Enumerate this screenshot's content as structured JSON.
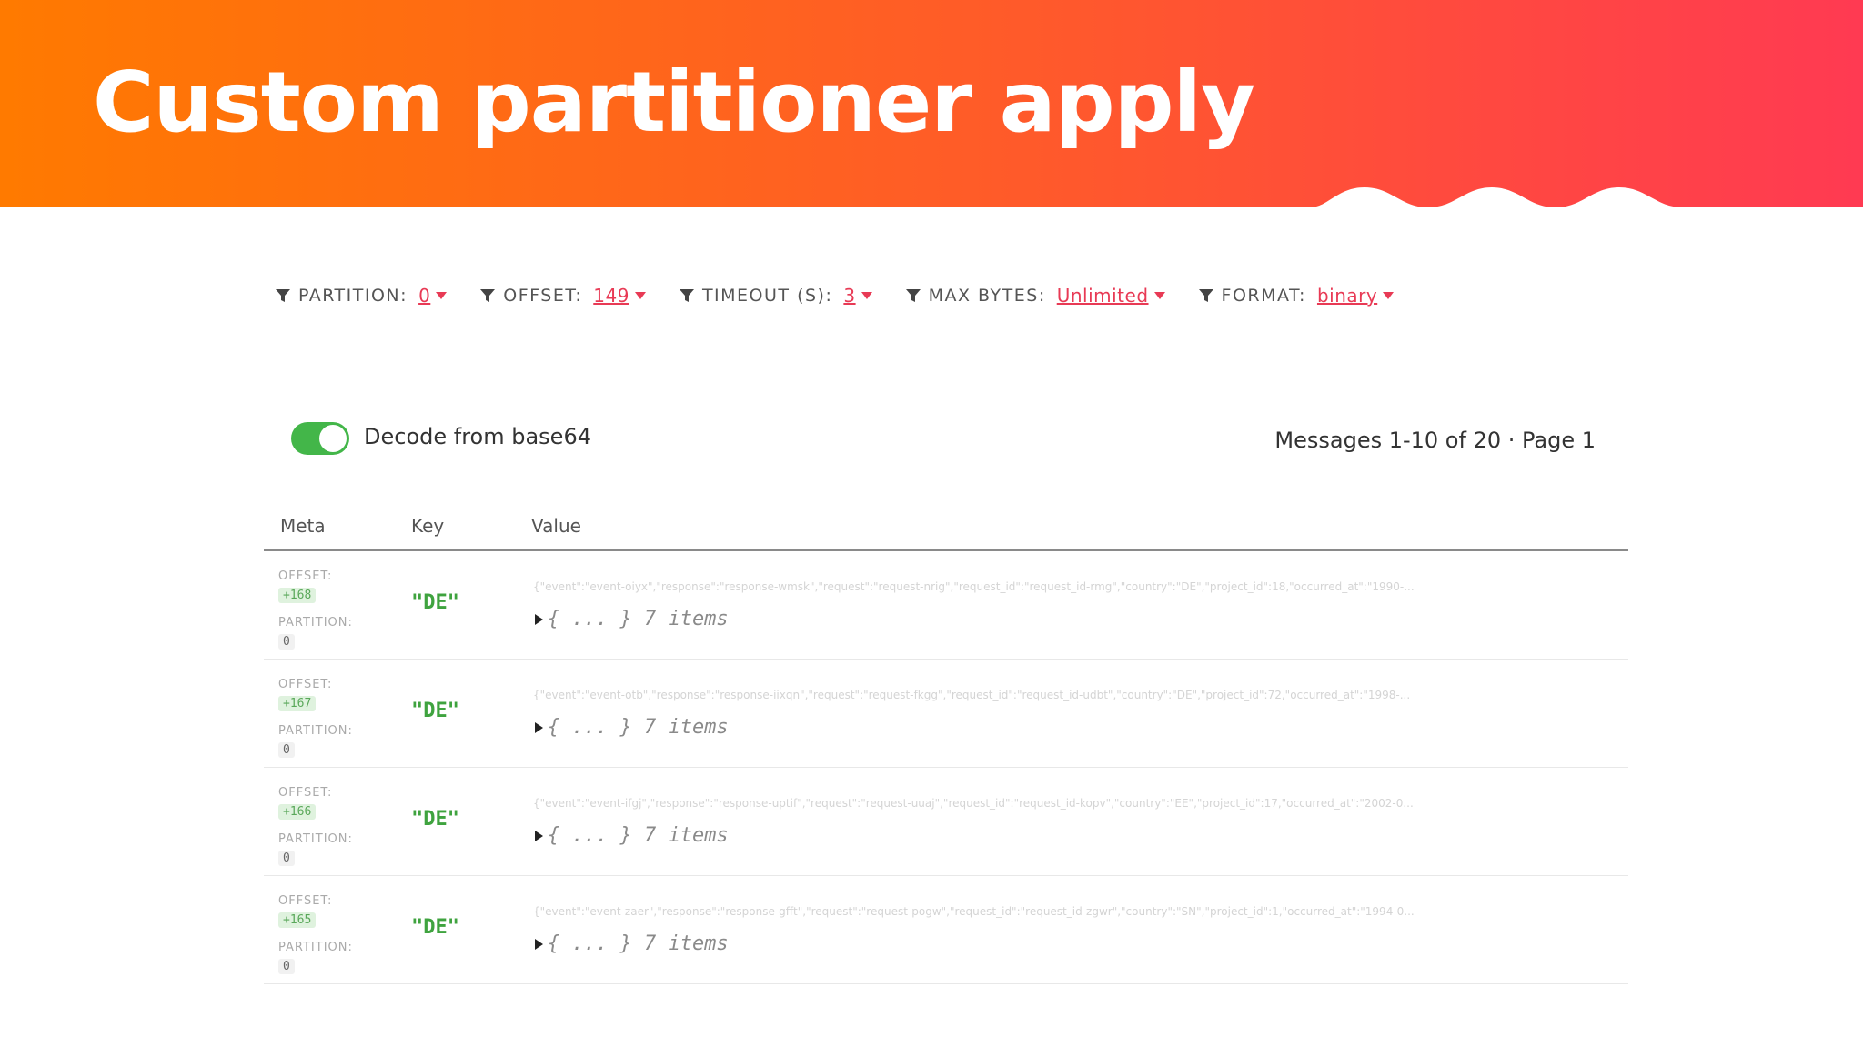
{
  "slide": {
    "title": "Custom partitioner apply"
  },
  "filters": [
    {
      "label": "PARTITION:",
      "value": "0"
    },
    {
      "label": "OFFSET:",
      "value": "149"
    },
    {
      "label": "TIMEOUT (S):",
      "value": "3"
    },
    {
      "label": "MAX BYTES:",
      "value": "Unlimited"
    },
    {
      "label": "FORMAT:",
      "value": "binary"
    }
  ],
  "decode": {
    "label": "Decode from base64",
    "enabled": true
  },
  "pager": {
    "text": "Messages 1-10 of 20 · Page 1"
  },
  "table": {
    "headers": {
      "meta": "Meta",
      "key": "Key",
      "value": "Value"
    },
    "meta_labels": {
      "offset": "OFFSET:",
      "partition": "PARTITION:"
    },
    "rows": [
      {
        "offset": "+168",
        "partition": "0",
        "key": "\"DE\"",
        "raw": "{\"event\":\"event-oiyx\",\"response\":\"response-wmsk\",\"request\":\"request-nrig\",\"request_id\":\"request_id-rmg\",\"country\":\"DE\",\"project_id\":18,\"occurred_at\":\"1990-...",
        "collapsed": "{ ... } 7 items"
      },
      {
        "offset": "+167",
        "partition": "0",
        "key": "\"DE\"",
        "raw": "{\"event\":\"event-otb\",\"response\":\"response-iixqn\",\"request\":\"request-fkgg\",\"request_id\":\"request_id-udbt\",\"country\":\"DE\",\"project_id\":72,\"occurred_at\":\"1998-...",
        "collapsed": "{ ... } 7 items"
      },
      {
        "offset": "+166",
        "partition": "0",
        "key": "\"DE\"",
        "raw": "{\"event\":\"event-ifgj\",\"response\":\"response-uptif\",\"request\":\"request-uuaj\",\"request_id\":\"request_id-kopv\",\"country\":\"EE\",\"project_id\":17,\"occurred_at\":\"2002-0...",
        "collapsed": "{ ... } 7 items"
      },
      {
        "offset": "+165",
        "partition": "0",
        "key": "\"DE\"",
        "raw": "{\"event\":\"event-zaer\",\"response\":\"response-gfft\",\"request\":\"request-pogw\",\"request_id\":\"request_id-zgwr\",\"country\":\"SN\",\"project_id\":1,\"occurred_at\":\"1994-0...",
        "collapsed": "{ ... } 7 items"
      }
    ]
  },
  "colors": {
    "header_start": "#ff7a00",
    "header_end": "#ff3a52",
    "filter_value": "#e83a55",
    "toggle_on": "#43b649",
    "key_text": "#3fa33f"
  },
  "icons": {
    "filter": "filter-funnel-icon",
    "caret": "caret-down-icon",
    "expand": "triangle-right-icon"
  }
}
